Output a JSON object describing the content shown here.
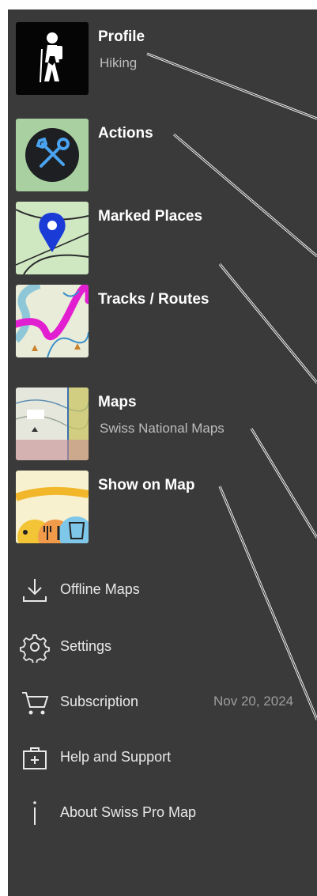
{
  "profile": {
    "label": "Profile",
    "subtitle": "Hiking",
    "icon": "hiker-icon"
  },
  "actions": {
    "label": "Actions",
    "icon": "tools-icon"
  },
  "marked_places": {
    "label": "Marked Places",
    "icon": "map-pin-icon"
  },
  "tracks_routes": {
    "label": "Tracks / Routes",
    "icon": "track-map-icon"
  },
  "maps": {
    "label": "Maps",
    "subtitle": "Swiss National Maps",
    "icon": "topo-map-icon"
  },
  "show_on_map": {
    "label": "Show on Map",
    "icon": "map-layers-icon"
  },
  "menu": {
    "offline_maps": {
      "label": "Offline Maps",
      "icon": "download-icon"
    },
    "settings": {
      "label": "Settings",
      "icon": "gear-icon"
    },
    "subscription": {
      "label": "Subscription",
      "date": "Nov 20, 2024",
      "icon": "cart-icon"
    },
    "help": {
      "label": "Help and Support",
      "icon": "first-aid-kit-icon"
    },
    "about": {
      "label": "About Swiss Pro Map",
      "icon": "info-icon"
    }
  },
  "colors": {
    "panel_background": "#3a3a3a",
    "pin_blue": "#1a3bd6",
    "track_magenta": "#e21fd0",
    "tile_green": "#a9d0a0"
  }
}
